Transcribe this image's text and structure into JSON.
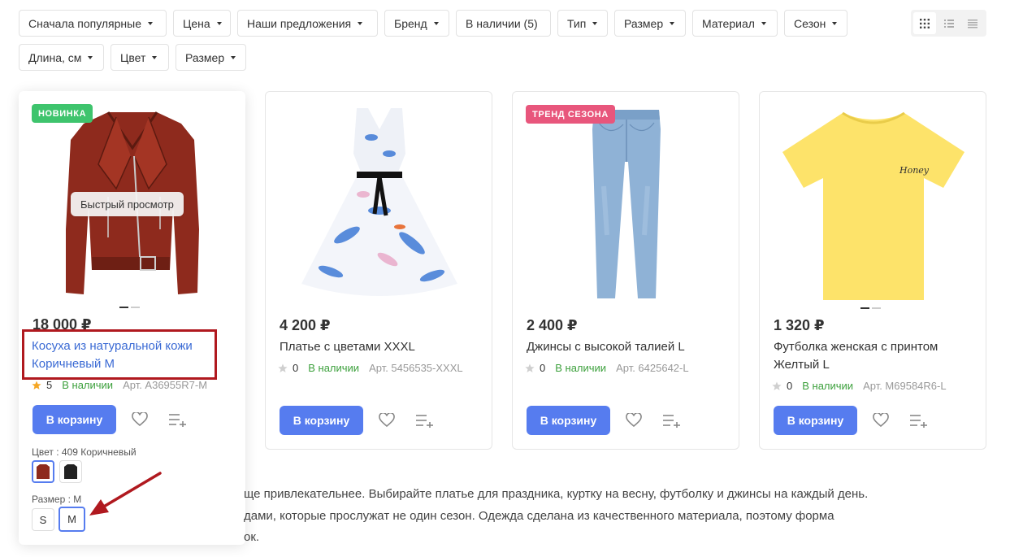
{
  "filters": [
    {
      "label": "Сначала популярные"
    },
    {
      "label": "Цена"
    },
    {
      "label": "Наши предложения"
    },
    {
      "label": "Бренд"
    },
    {
      "label": "В наличии (5)"
    },
    {
      "label": "Тип"
    },
    {
      "label": "Размер"
    },
    {
      "label": "Материал"
    },
    {
      "label": "Сезон"
    },
    {
      "label": "Длина, см"
    },
    {
      "label": "Цвет"
    },
    {
      "label": "Размер"
    }
  ],
  "view_modes": [
    "grid-icon",
    "list-icon",
    "compact-list-icon"
  ],
  "products": [
    {
      "badge": "НОВИНКА",
      "quick_view": "Быстрый просмотр",
      "price": "18 000 ₽",
      "title_line1": "Косуха из натуральной кожи",
      "title_line2": "Коричневый M",
      "rating": "5",
      "stock": "В наличии",
      "article": "Арт. A36955R7-M",
      "cart_label": "В корзину",
      "color_label": "Цвет : 409 Коричневый",
      "size_label": "Размер : M",
      "sizes": [
        "S",
        "M"
      ]
    },
    {
      "price": "4 200 ₽",
      "title_line1": "Платье с цветами XXXL",
      "rating": "0",
      "stock": "В наличии",
      "article": "Арт. 5456535-XXXL",
      "cart_label": "В корзину"
    },
    {
      "badge": "ТРЕНД СЕЗОНА",
      "price": "2 400 ₽",
      "title_line1": "Джинсы с высокой талией L",
      "rating": "0",
      "stock": "В наличии",
      "article": "Арт. 6425642-L",
      "cart_label": "В корзину"
    },
    {
      "price": "1 320 ₽",
      "title_line1": "Футболка женская с принтом",
      "title_line2": "Желтый L",
      "print_text": "Honey",
      "rating": "0",
      "stock": "В наличии",
      "article": "Арт. M69584R6-L",
      "cart_label": "В корзину"
    }
  ],
  "description": [
    "ще привлекательнее. Выбирайте платье для праздника, куртку на весну, футболку и джинсы на каждый день.",
    "дами, которые прослужат не один сезон. Одежда сделана из качественного материала, поэтому форма",
    "ок."
  ],
  "colors": {
    "accent": "#567cef",
    "link": "#3a6ad4",
    "stock": "#3ca03c",
    "new_badge": "#3ec46d",
    "trend_badge": "#e8567c",
    "highlight": "#b0191f",
    "star": "#f5a623"
  }
}
